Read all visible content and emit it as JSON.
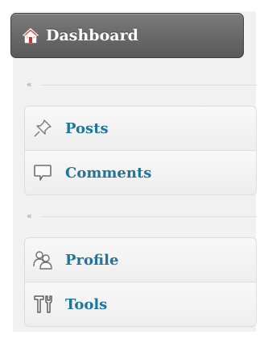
{
  "menu": {
    "dashboard": {
      "label": "Dashboard",
      "icon": "home-icon"
    },
    "collapse_glyph": "«",
    "group1": [
      {
        "label": "Posts",
        "icon": "pushpin-icon"
      },
      {
        "label": "Comments",
        "icon": "comment-bubble-icon"
      }
    ],
    "group2": [
      {
        "label": "Profile",
        "icon": "users-icon"
      },
      {
        "label": "Tools",
        "icon": "tools-icon"
      }
    ]
  },
  "colors": {
    "link": "#21759b",
    "active_bg": "#6b6b6b",
    "home_roof": "#e23a3a"
  }
}
